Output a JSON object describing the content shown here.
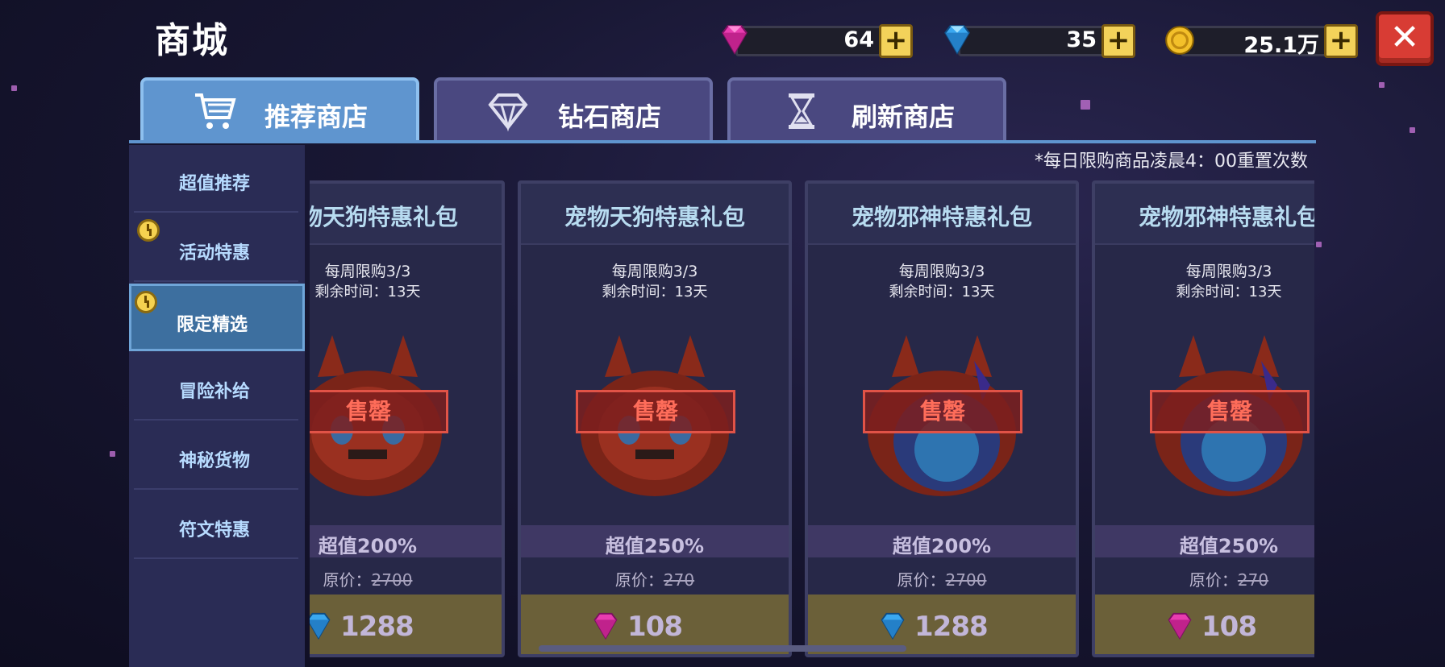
{
  "title": "商城",
  "currencies": [
    {
      "name": "pink-gem",
      "value": "64",
      "color": "#e83cb0"
    },
    {
      "name": "blue-diamond",
      "value": "35",
      "color": "#3aa8f0"
    },
    {
      "name": "gold-coin",
      "value": "25.1万",
      "color": "#f3c02a"
    }
  ],
  "plus_symbol": "+",
  "close_symbol": "✕",
  "tabs": [
    {
      "label": "推荐商店",
      "icon": "cart-icon",
      "active": true
    },
    {
      "label": "钻石商店",
      "icon": "diamond-icon",
      "active": false
    },
    {
      "label": "刷新商店",
      "icon": "hourglass-icon",
      "active": false
    }
  ],
  "notice": "*每日限购商品凌晨4：00重置次数",
  "sidebar": [
    {
      "label": "超值推荐",
      "badge": false,
      "active": false
    },
    {
      "label": "活动特惠",
      "badge": true,
      "active": false
    },
    {
      "label": "限定精选",
      "badge": true,
      "active": true
    },
    {
      "label": "冒险补给",
      "badge": false,
      "active": false
    },
    {
      "label": "神秘货物",
      "badge": false,
      "active": false
    },
    {
      "label": "符文特惠",
      "badge": false,
      "active": false
    }
  ],
  "products": [
    {
      "title": "宠物天狗特惠礼包",
      "limit": "每周限购3/3",
      "time": "剩余时间：13天",
      "sold": "售罄",
      "value": "超值200%",
      "orig_label": "原价：",
      "orig": "2700",
      "price": "1288",
      "currency": "blue-diamond"
    },
    {
      "title": "宠物天狗特惠礼包",
      "limit": "每周限购3/3",
      "time": "剩余时间：13天",
      "sold": "售罄",
      "value": "超值250%",
      "orig_label": "原价：",
      "orig": "270",
      "price": "108",
      "currency": "pink-gem"
    },
    {
      "title": "宠物邪神特惠礼包",
      "limit": "每周限购3/3",
      "time": "剩余时间：13天",
      "sold": "售罄",
      "value": "超值200%",
      "orig_label": "原价：",
      "orig": "2700",
      "price": "1288",
      "currency": "blue-diamond"
    },
    {
      "title": "宠物邪神特惠礼包",
      "limit": "每周限购3/3",
      "time": "剩余时间：13天",
      "sold": "售罄",
      "value": "超值250%",
      "orig_label": "原价：",
      "orig": "270",
      "price": "108",
      "currency": "pink-gem"
    }
  ]
}
